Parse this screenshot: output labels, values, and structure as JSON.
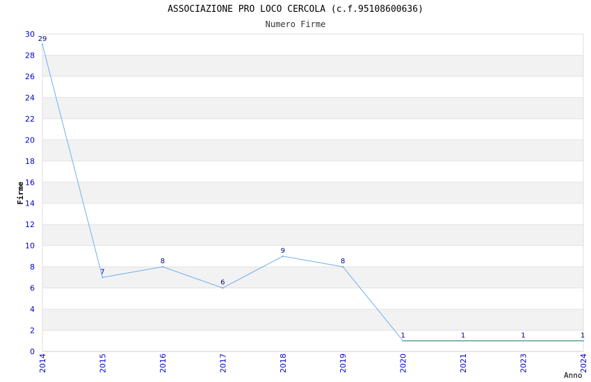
{
  "chart_data": {
    "type": "line",
    "title": "ASSOCIAZIONE PRO LOCO CERCOLA (c.f.95108600636)",
    "subtitle": "Numero Firme",
    "xlabel": "Anno",
    "ylabel": "Firme",
    "categories": [
      "2014",
      "2015",
      "2016",
      "2017",
      "2018",
      "2019",
      "2020",
      "2021",
      "2023",
      "2024"
    ],
    "series": [
      {
        "values": [
          29,
          7,
          8,
          6,
          9,
          8,
          1,
          1,
          1,
          1
        ]
      }
    ],
    "data_labels": [
      "29",
      "7",
      "8",
      "6",
      "9",
      "8",
      "1",
      "1",
      "1",
      "1"
    ],
    "ylim": [
      0,
      30
    ],
    "yticks": [
      "0",
      "2",
      "4",
      "6",
      "8",
      "10",
      "12",
      "14",
      "16",
      "18",
      "20",
      "22",
      "24",
      "26",
      "28",
      "30"
    ],
    "grid": true,
    "colors": {
      "line": "#6eb0ec",
      "baseline": "#2e8b57",
      "band": "#f2f2f2",
      "tick_text": "#0000cc",
      "label_text": "#000080"
    }
  }
}
